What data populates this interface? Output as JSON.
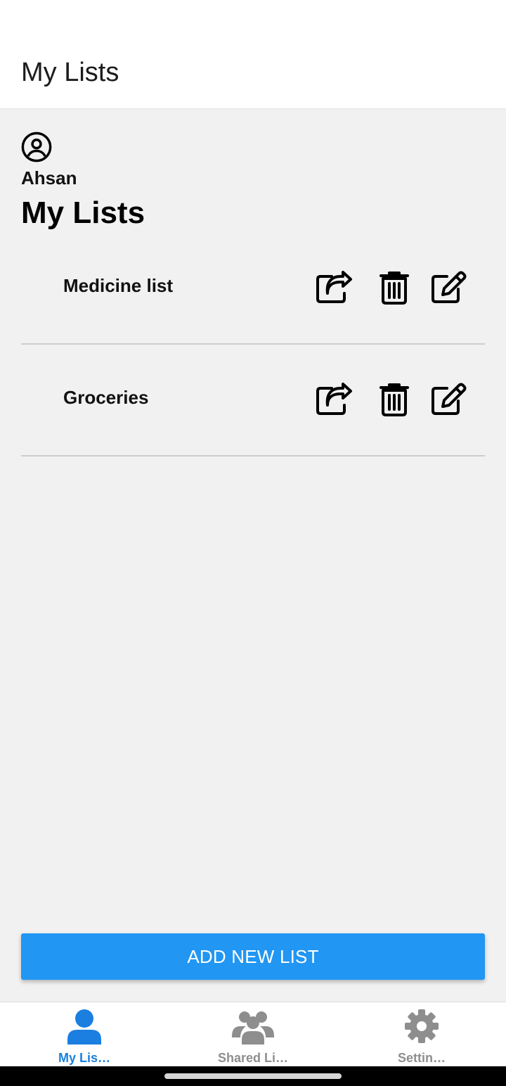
{
  "header": {
    "title": "My Lists"
  },
  "profile": {
    "icon": "user-circle-icon",
    "name": "Ahsan"
  },
  "section": {
    "title": "My Lists"
  },
  "lists": [
    {
      "name": "Medicine list"
    },
    {
      "name": "Groceries"
    }
  ],
  "row_actions": {
    "share_icon": "share-icon",
    "delete_icon": "trash-icon",
    "edit_icon": "edit-icon"
  },
  "add_button": {
    "label": "ADD NEW LIST"
  },
  "nav": {
    "items": [
      {
        "label": "My Lis…",
        "icon": "user-icon",
        "active": true
      },
      {
        "label": "Shared Li…",
        "icon": "users-icon",
        "active": false
      },
      {
        "label": "Settin…",
        "icon": "gear-icon",
        "active": false
      }
    ]
  },
  "colors": {
    "accent": "#2196f3",
    "nav_active": "#1a7fe0",
    "nav_inactive": "#8e8e8e",
    "background": "#f1f1f1"
  }
}
